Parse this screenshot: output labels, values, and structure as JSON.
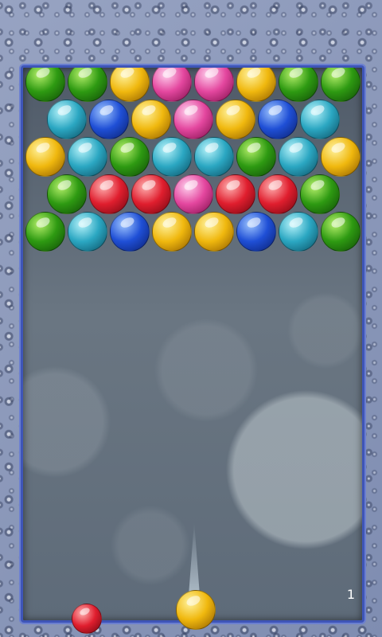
{
  "colors": {
    "green": [
      "#b6f06a",
      "#2e9a12",
      "#0f4a06"
    ],
    "teal": [
      "#b8f4fb",
      "#2ba7c2",
      "#0b4f63"
    ],
    "blue": [
      "#9fc6ff",
      "#1f4fd6",
      "#0a1f6e"
    ],
    "yellow": [
      "#fff3a0",
      "#f0b80e",
      "#8c5a00"
    ],
    "pink": [
      "#ffd1ee",
      "#e4479f",
      "#7d0e4a"
    ],
    "red": [
      "#ffb0b0",
      "#e01e2e",
      "#700610"
    ]
  },
  "grid": [
    [
      "green",
      "green",
      "yellow",
      "pink",
      "pink",
      "yellow",
      "green",
      "green"
    ],
    [
      "teal",
      "blue",
      "yellow",
      "pink",
      "yellow",
      "blue",
      "teal"
    ],
    [
      "yellow",
      "teal",
      "green",
      "teal",
      "teal",
      "green",
      "teal",
      "yellow"
    ],
    [
      "green",
      "red",
      "red",
      "pink",
      "red",
      "red",
      "green"
    ],
    [
      "green",
      "teal",
      "blue",
      "yellow",
      "yellow",
      "blue",
      "teal",
      "green"
    ]
  ],
  "shooter": {
    "color": "yellow"
  },
  "next": {
    "color": "red"
  },
  "level": "1"
}
